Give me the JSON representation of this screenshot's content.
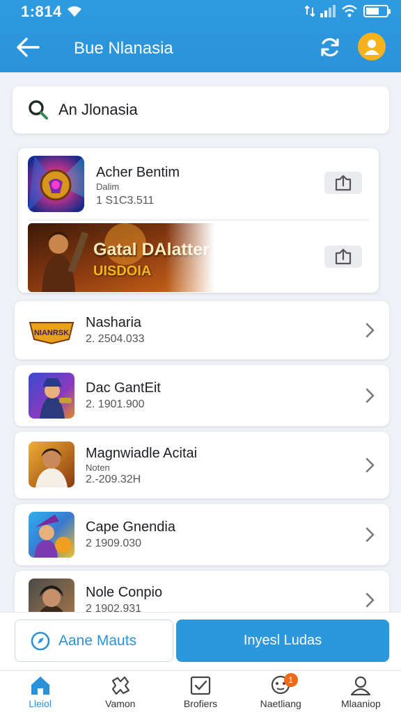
{
  "status_bar": {
    "time": "1:814"
  },
  "header": {
    "title": "Bue Nlanasia"
  },
  "search": {
    "value": "An Jlonasia",
    "placeholder": ""
  },
  "featured": {
    "app": {
      "name": "Acher Bentim",
      "subtitle": "Dalim",
      "meta": "1 S1C3.511"
    },
    "banner": {
      "line1": "Gatal DAlatter",
      "line2": "UISDOIA"
    }
  },
  "list": [
    {
      "name": "Nasharia",
      "subtitle": "",
      "meta": "2. 2504.033",
      "icon_text": "NIANRSK"
    },
    {
      "name": "Dac GantEit",
      "subtitle": "",
      "meta": "2. 1901.900",
      "icon_text": ""
    },
    {
      "name": "Magnwiadle Acitai",
      "subtitle": "Noten",
      "meta": "2.-209.32H",
      "icon_text": ""
    },
    {
      "name": "Cape Gnendia",
      "subtitle": "",
      "meta": "2 1909.030",
      "icon_text": ""
    },
    {
      "name": "Nole Conpio",
      "subtitle": "",
      "meta": "2 1902.931",
      "icon_text": ""
    }
  ],
  "actions": {
    "secondary_label": "Aane Mauts",
    "primary_label": "Inyesl Ludas"
  },
  "tabs": [
    {
      "label": "Lleiol",
      "icon": "home-icon",
      "active": true
    },
    {
      "label": "Vamon",
      "icon": "puzzle-icon",
      "active": false
    },
    {
      "label": "Brofiers",
      "icon": "checkbox-icon",
      "active": false
    },
    {
      "label": "Naetliang",
      "icon": "chat-icon",
      "active": false,
      "badge": "1"
    },
    {
      "label": "Mlaaniop",
      "icon": "profile-icon",
      "active": false
    }
  ],
  "colors": {
    "primary": "#2a92d8",
    "header": "#2e9be0",
    "avatar": "#f5b21b",
    "badge": "#f06a1a"
  }
}
